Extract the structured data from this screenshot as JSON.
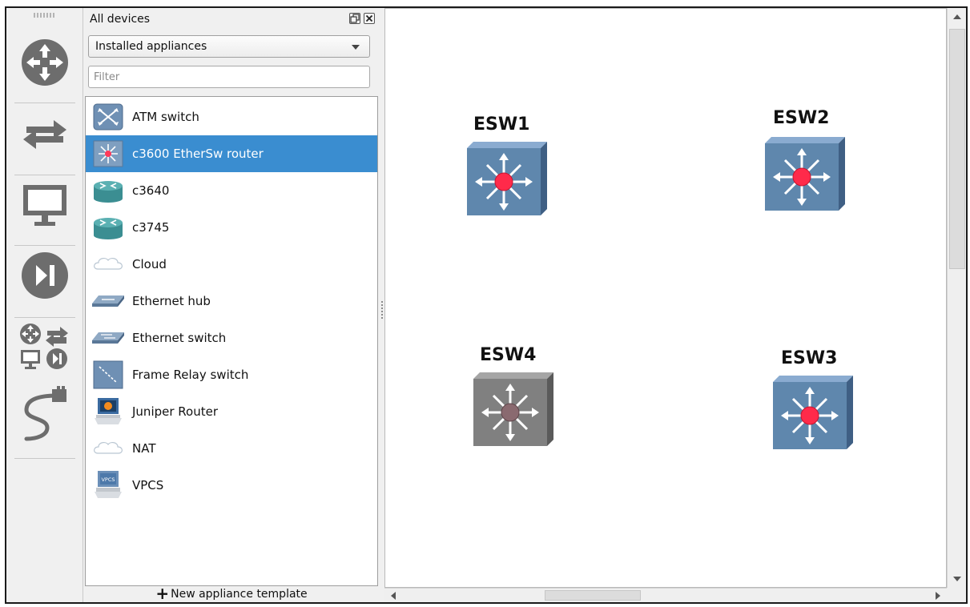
{
  "toolbar": {
    "buttons": [
      {
        "name": "routers-category",
        "icon": "router-icon"
      },
      {
        "name": "switches-category",
        "icon": "switch-arrows-icon"
      },
      {
        "name": "end-devices-category",
        "icon": "monitor-icon"
      },
      {
        "name": "security-devices-category",
        "icon": "play-pause-icon"
      },
      {
        "name": "all-devices-category",
        "icon": "all-devices-icon"
      },
      {
        "name": "add-link",
        "icon": "cable-icon"
      }
    ]
  },
  "dock": {
    "title": "All devices",
    "filter_select": "Installed appliances",
    "filter_placeholder": "Filter",
    "new_template_label": "New appliance template"
  },
  "devices": [
    {
      "label": "ATM switch",
      "icon": "atm-switch-icon",
      "selected": false
    },
    {
      "label": "c3600 EtherSw router",
      "icon": "etherswitch-router-icon",
      "selected": true
    },
    {
      "label": "c3640",
      "icon": "cisco-router-icon",
      "selected": false
    },
    {
      "label": "c3745",
      "icon": "cisco-router-icon",
      "selected": false
    },
    {
      "label": "Cloud",
      "icon": "cloud-icon",
      "selected": false
    },
    {
      "label": "Ethernet hub",
      "icon": "ethernet-hub-icon",
      "selected": false
    },
    {
      "label": "Ethernet switch",
      "icon": "ethernet-switch-icon",
      "selected": false
    },
    {
      "label": "Frame Relay switch",
      "icon": "frame-relay-switch-icon",
      "selected": false
    },
    {
      "label": "Juniper Router",
      "icon": "juniper-router-icon",
      "selected": false
    },
    {
      "label": "NAT",
      "icon": "cloud-icon",
      "selected": false
    },
    {
      "label": "VPCS",
      "icon": "vpcs-icon",
      "selected": false
    }
  ],
  "canvas": {
    "nodes": [
      {
        "label": "ESW1",
        "icon": "multilayer-switch-icon",
        "status": "active"
      },
      {
        "label": "ESW2",
        "icon": "multilayer-switch-icon",
        "status": "active"
      },
      {
        "label": "ESW4",
        "icon": "multilayer-switch-icon",
        "status": "inactive"
      },
      {
        "label": "ESW3",
        "icon": "multilayer-switch-icon",
        "status": "active"
      }
    ]
  },
  "colors": {
    "selection": "#3a8dd0",
    "switch_active": "#5f87ad",
    "switch_inactive": "#808080",
    "led_active": "#ff2a4a",
    "led_inactive": "#8a6a70"
  }
}
